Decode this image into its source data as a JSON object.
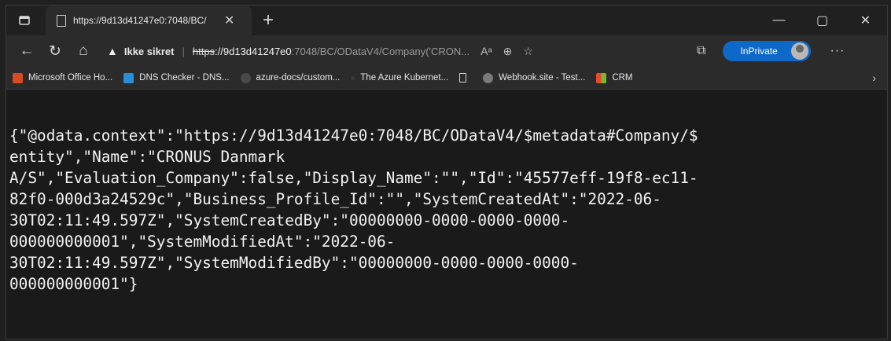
{
  "tab": {
    "title": "https://9d13d41247e0:7048/BC/",
    "page_icon": "page-icon",
    "close_icon": "close-icon"
  },
  "window_controls": {
    "minimize": "—",
    "maximize": "▢",
    "close": "✕"
  },
  "toolbar": {
    "back": "←",
    "reload": "↻",
    "home": "⌂",
    "security_label": "Ikke sikret",
    "url_scheme": "https",
    "url_host": "://9d13d41247e0",
    "url_path": ":7048/BC/ODataV4/Company('CRON...",
    "read_aloud_icon": "Aᵃ",
    "zoom_icon": "⊕",
    "favorite_icon": "☆",
    "collections_icon": "⧉",
    "inprivate_label": "InPrivate",
    "more_icon": "···"
  },
  "favorites": [
    {
      "label": "Microsoft Office Ho...",
      "color": "#d84b20"
    },
    {
      "label": "DNS Checker - DNS...",
      "color": "#2a8fd6"
    },
    {
      "label": "azure-docs/custom...",
      "color": "#5a5a5a"
    },
    {
      "label": "The Azure Kubernet...",
      "color": "#3a3a3a"
    },
    {
      "label": "",
      "color": "#2b2b2b"
    },
    {
      "label": "Webhook.site - Test...",
      "color": "#6a6a6a"
    },
    {
      "label": "CRM",
      "color": "#e8a020"
    }
  ],
  "content": {
    "json_text": "{\"@odata.context\":\"https://9d13d41247e0:7048/BC/ODataV4/$metadata#Company/$entity\",\"Name\":\"CRONUS Danmark A/S\",\"Evaluation_Company\":false,\"Display_Name\":\"\",\"Id\":\"45577eff-19f8-ec11-82f0-000d3a24529c\",\"Business_Profile_Id\":\"\",\"SystemCreatedAt\":\"2022-06-30T02:11:49.597Z\",\"SystemCreatedBy\":\"00000000-0000-0000-0000-000000000001\",\"SystemModifiedAt\":\"2022-06-30T02:11:49.597Z\",\"SystemModifiedBy\":\"00000000-0000-0000-0000-000000000001\"}",
    "lines": [
      "{\"@odata.context\":\"https://9d13d41247e0:7048/BC/ODataV4/$metadata#Company/$",
      "entity\",\"Name\":\"CRONUS Danmark",
      "A/S\",\"Evaluation_Company\":false,\"Display_Name\":\"\",\"Id\":\"45577eff-19f8-ec11-",
      "82f0-000d3a24529c\",\"Business_Profile_Id\":\"\",\"SystemCreatedAt\":\"2022-06-",
      "30T02:11:49.597Z\",\"SystemCreatedBy\":\"00000000-0000-0000-0000-",
      "000000000001\",\"SystemModifiedAt\":\"2022-06-",
      "30T02:11:49.597Z\",\"SystemModifiedBy\":\"00000000-0000-0000-0000-",
      "000000000001\"}"
    ]
  }
}
